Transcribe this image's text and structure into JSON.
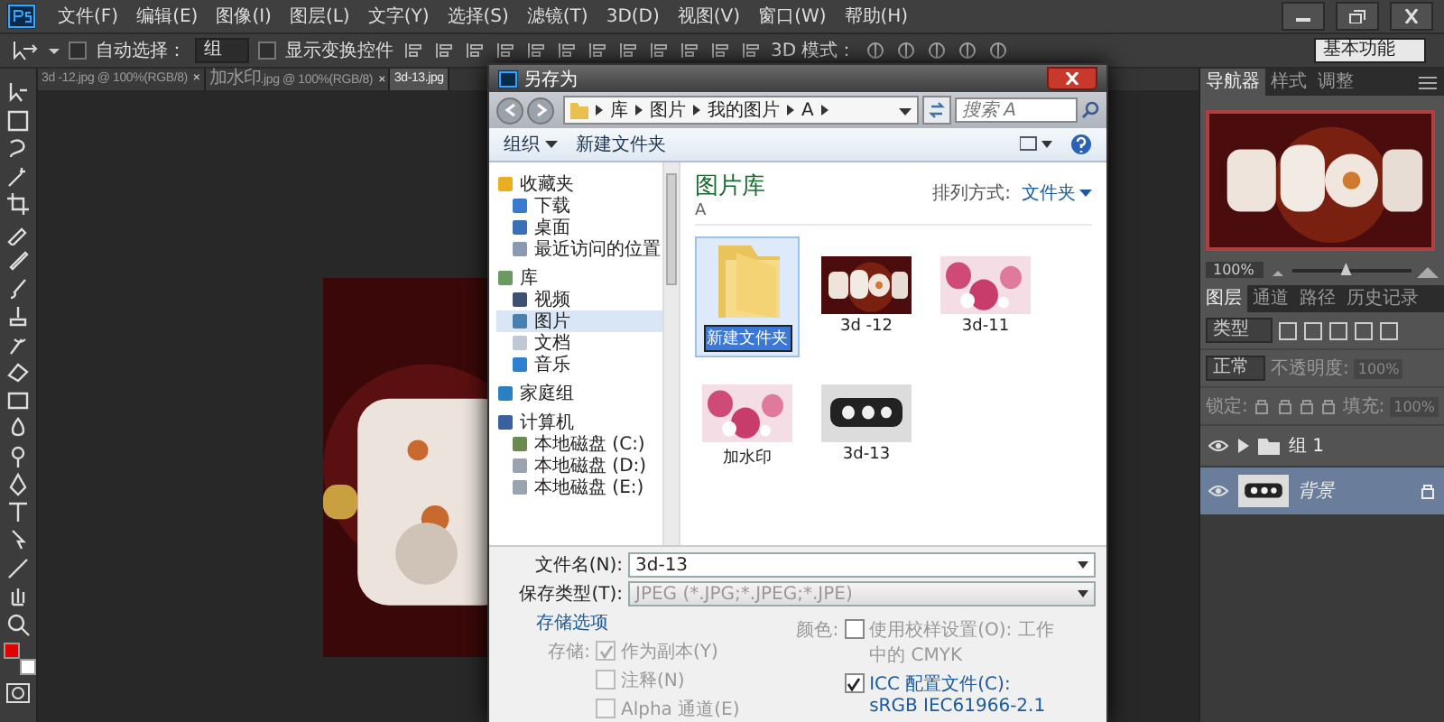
{
  "menubar": {
    "menus": [
      "文件(F)",
      "编辑(E)",
      "图像(I)",
      "图层(L)",
      "文字(Y)",
      "选择(S)",
      "滤镜(T)",
      "3D(D)",
      "视图(V)",
      "窗口(W)",
      "帮助(H)"
    ]
  },
  "options": {
    "auto_select": {
      "label": "自动选择：",
      "checked": false
    },
    "auto_select_target": "组",
    "show_transform": {
      "label": "显示变换控件",
      "checked": false
    },
    "mode_3d_label": "3D 模式：",
    "workspace": "基本功能"
  },
  "doc_tabs": [
    {
      "label": "3d -12.jpg @ 100%(RGB/8)",
      "close": "×",
      "selected": false
    },
    {
      "label": "加水印.jpg @ 100%(RGB/8)",
      "close": "×",
      "selected": false
    },
    {
      "label": "3d-13.jpg",
      "selected": true
    }
  ],
  "swatches": [
    {
      "kind": "foreground",
      "color": "#e00000"
    },
    {
      "kind": "background",
      "color": "#ffffff"
    }
  ],
  "dialog": {
    "title": "另存为",
    "breadcrumb": [
      "库",
      "图片",
      "我的图片",
      "A"
    ],
    "search": {
      "placeholder": "搜索 A"
    },
    "organize": "组织",
    "new_folder": "新建文件夹",
    "nav": [
      {
        "label": "收藏夹",
        "kind": "favorites",
        "selected": false,
        "children": [
          {
            "label": "下载",
            "kind": "download",
            "selected": false
          },
          {
            "label": "桌面",
            "kind": "desktop",
            "selected": false
          },
          {
            "label": "最近访问的位置",
            "kind": "recent",
            "selected": false
          }
        ]
      },
      {
        "label": "库",
        "kind": "library",
        "selected": false,
        "children": [
          {
            "label": "视频",
            "kind": "video",
            "selected": false
          },
          {
            "label": "图片",
            "kind": "pictures",
            "selected": true
          },
          {
            "label": "文档",
            "kind": "documents",
            "selected": false
          },
          {
            "label": "音乐",
            "kind": "music",
            "selected": false
          }
        ]
      },
      {
        "label": "家庭组",
        "kind": "homegroup",
        "selected": false
      },
      {
        "label": "计算机",
        "kind": "computer",
        "selected": false,
        "children": [
          {
            "label": "本地磁盘 (C:)",
            "kind": "system-disk",
            "selected": false
          },
          {
            "label": "本地磁盘 (D:)",
            "kind": "disk",
            "selected": false
          },
          {
            "label": "本地磁盘 (E:)",
            "kind": "disk",
            "selected": false
          }
        ]
      }
    ],
    "library": {
      "title": "图片库",
      "subtitle": "A",
      "arrange_label": "排列方式:",
      "arrange_value": "文件夹"
    },
    "files": [
      {
        "name": "新建文件夹",
        "kind": "folder",
        "selected": true
      },
      {
        "name": "3d -12",
        "kind": "picture",
        "selected": false
      },
      {
        "name": "3d-11",
        "kind": "picture",
        "selected": false
      },
      {
        "name": "加水印",
        "kind": "picture",
        "selected": false
      },
      {
        "name": "3d-13",
        "kind": "picture",
        "selected": false
      }
    ],
    "filename": {
      "label": "文件名(N):",
      "value": "3d-13"
    },
    "filetype": {
      "label": "保存类型(T):",
      "value": "JPEG (*.JPG;*.JPEG;*.JPE)"
    },
    "save_options_link": "存储选项",
    "save_label": "存储:",
    "save_checks": [
      {
        "label": "作为副本(Y)",
        "checked": true,
        "disabled": true
      },
      {
        "label": "注释(N)",
        "checked": false,
        "disabled": true
      },
      {
        "label": "Alpha 通道(E)",
        "checked": false,
        "disabled": true
      }
    ],
    "color_label": "颜色:",
    "color_checks": [
      {
        "label": "使用校样设置(O): 工作中的 CMYK",
        "checked": false,
        "link": false
      },
      {
        "label": "ICC 配置文件(C): sRGB IEC61966-2.1",
        "checked": true,
        "link": true
      }
    ]
  },
  "panels": {
    "top_tabs": [
      {
        "label": "导航器",
        "selected": true
      },
      {
        "label": "样式",
        "selected": false
      },
      {
        "label": "调整",
        "selected": false
      }
    ],
    "zoom": {
      "reading": "100%",
      "level": 0.45
    },
    "layer_tabs": [
      {
        "label": "图层",
        "selected": true
      },
      {
        "label": "通道",
        "selected": false
      },
      {
        "label": "路径",
        "selected": false
      },
      {
        "label": "历史记录",
        "selected": false
      }
    ],
    "filter": "类型",
    "blend": "正常",
    "opacity_label": "不透明度:",
    "opacity": "100%",
    "lock_label": "锁定:",
    "fill_label": "填充:",
    "fill": "100%",
    "layers": [
      {
        "name": "组 1",
        "kind": "group",
        "selected": false,
        "visible": true,
        "locked": false
      },
      {
        "name": "背景",
        "selected": true,
        "visible": true,
        "locked": true
      }
    ]
  }
}
